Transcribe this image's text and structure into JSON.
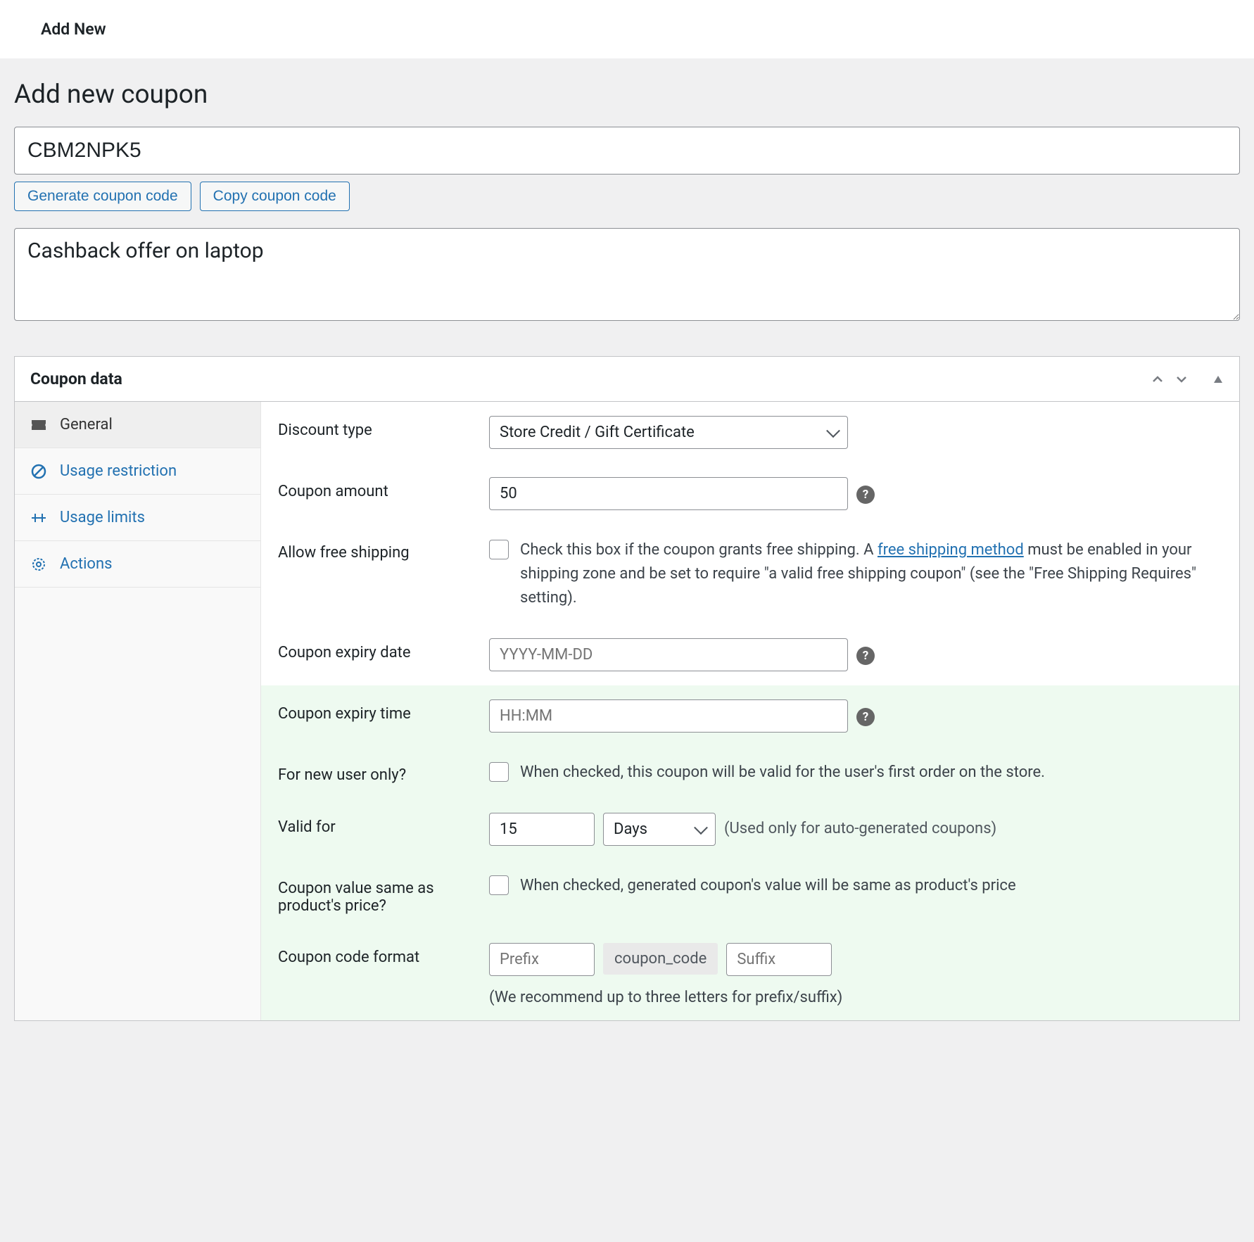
{
  "topbar": {
    "add_new": "Add New"
  },
  "page": {
    "title": "Add new coupon"
  },
  "coupon": {
    "code": "CBM2NPK5",
    "description": "Cashback offer on laptop"
  },
  "buttons": {
    "generate": "Generate coupon code",
    "copy": "Copy coupon code"
  },
  "panel": {
    "title": "Coupon data"
  },
  "tabs": {
    "general": "General",
    "usage_restriction": "Usage restriction",
    "usage_limits": "Usage limits",
    "actions": "Actions"
  },
  "form": {
    "discount_type": {
      "label": "Discount type",
      "value": "Store Credit / Gift Certificate"
    },
    "coupon_amount": {
      "label": "Coupon amount",
      "value": "50"
    },
    "free_shipping": {
      "label": "Allow free shipping",
      "hint_before": "Check this box if the coupon grants free shipping. A ",
      "hint_link": "free shipping method",
      "hint_after": " must be enabled in your shipping zone and be set to require \"a valid free shipping coupon\" (see the \"Free Shipping Requires\" setting)."
    },
    "expiry_date": {
      "label": "Coupon expiry date",
      "placeholder": "YYYY-MM-DD"
    },
    "expiry_time": {
      "label": "Coupon expiry time",
      "placeholder": "HH:MM"
    },
    "new_user": {
      "label": "For new user only?",
      "hint": "When checked, this coupon will be valid for the user's first order on the store."
    },
    "valid_for": {
      "label": "Valid for",
      "value": "15",
      "unit": "Days",
      "hint": "(Used only for auto-generated coupons)"
    },
    "same_as_price": {
      "label": "Coupon value same as product's price?",
      "hint": "When checked, generated coupon's value will be same as product's price"
    },
    "code_format": {
      "label": "Coupon code format",
      "prefix_placeholder": "Prefix",
      "mid": "coupon_code",
      "suffix_placeholder": "Suffix",
      "note": "(We recommend up to three letters for prefix/suffix)"
    }
  }
}
